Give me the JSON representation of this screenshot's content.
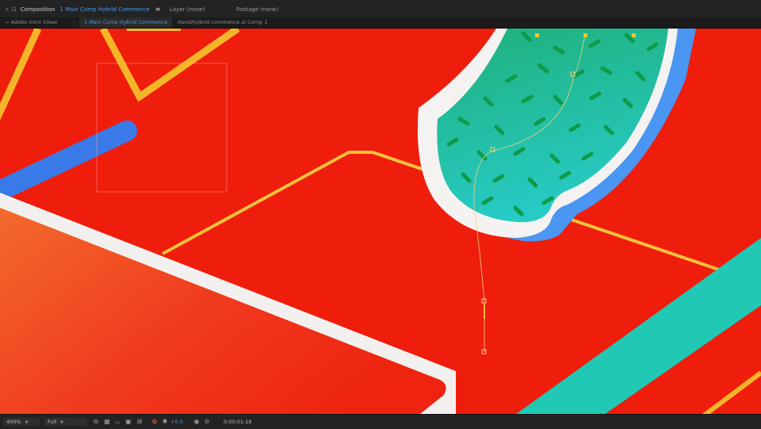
{
  "panel_tabs": {
    "composition": {
      "label": "Composition",
      "active_name": "1 Main Comp Hybrid Commence"
    },
    "layer": {
      "label": "Layer",
      "value": "(none)"
    },
    "footage": {
      "label": "Footage",
      "value": "(none)"
    }
  },
  "breadcrumbs": [
    {
      "label": "Adobe Intro 10sec"
    },
    {
      "label": "1 Main Comp Hybrid Commence"
    },
    {
      "label": "Hand/hybrid-commence.ai Comp 1"
    }
  ],
  "viewer_bar": {
    "zoom": "400%",
    "resolution": "Full",
    "exposure": "+0.0",
    "timecode": "0:00:01:18"
  },
  "colors": {
    "accent": "#4a9bea",
    "canvas_red": "#ef1d0c",
    "stripe_yellow": "#f5b528",
    "teal": "#21c8b4",
    "blue": "#3a7ae8"
  },
  "icons": [
    "close-icon",
    "lock-icon",
    "panel-menu-icon",
    "zoom-caret-icon",
    "region-icon",
    "transparency-grid-icon",
    "mask-path-icon",
    "toggle-icon",
    "color-wheel-icon",
    "exposure-icon",
    "snapshot-icon",
    "show-snapshot-icon"
  ]
}
